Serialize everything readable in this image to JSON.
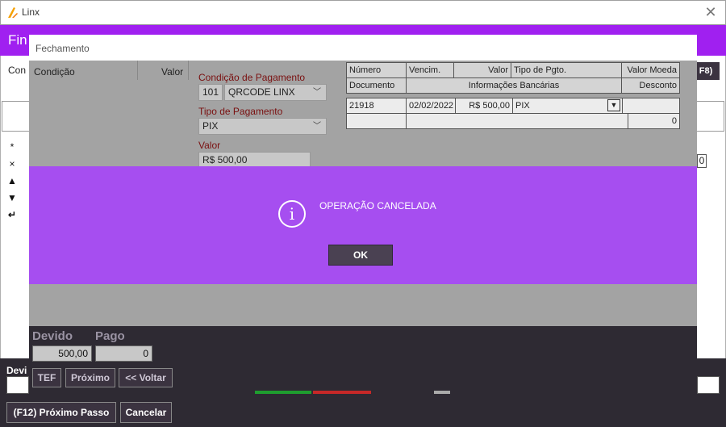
{
  "window": {
    "title": "Linx",
    "close_icon": "close-icon"
  },
  "page": {
    "title_partial": "Fin",
    "condition_partial": "Con",
    "f8_label": "F8)",
    "side_icons": [
      "*",
      "×",
      "▲",
      "▼",
      "↵"
    ],
    "zero_value": "0",
    "devido_partial": "Devi"
  },
  "bottom_buttons": {
    "next_step": "(F12) Próximo Passo",
    "cancel": "Cancelar"
  },
  "modal": {
    "title": "Fechamento",
    "left_table": {
      "col_condicao": "Condição",
      "col_valor": "Valor"
    },
    "condicao_label": "Condição de Pagamento",
    "condicao_code": "101",
    "condicao_value": "QRCODE LINX",
    "tipo_label": "Tipo de Pagamento",
    "tipo_value": "PIX",
    "valor_label": "Valor",
    "valor_value": "R$ 500,00",
    "grid": {
      "headers_row1": [
        "Número",
        "Vencim.",
        "Valor",
        "Tipo de Pgto.",
        "Valor Moeda"
      ],
      "headers_row2": [
        "Documento",
        "Informações Bancárias",
        "Desconto"
      ],
      "row1": {
        "numero": "21918",
        "vencimento": "02/02/2022",
        "valor": "R$ 500,00",
        "tipo": "PIX",
        "dropdown": "▼"
      },
      "row2": {
        "desconto": "0"
      }
    },
    "footer": {
      "devido_label": "Devido",
      "pago_label": "Pago",
      "devido_value": "500,00",
      "pago_value": "0",
      "btn_tef": "TEF",
      "btn_proximo": "Próximo",
      "btn_voltar": "<< Voltar"
    }
  },
  "alert": {
    "message": "OPERAÇÃO CANCELADA",
    "ok_label": "OK",
    "icon": "info-icon",
    "color": "#a64ef0"
  },
  "colors": {
    "brand_purple": "#a020f0",
    "dark_bar": "#2e2a33"
  }
}
